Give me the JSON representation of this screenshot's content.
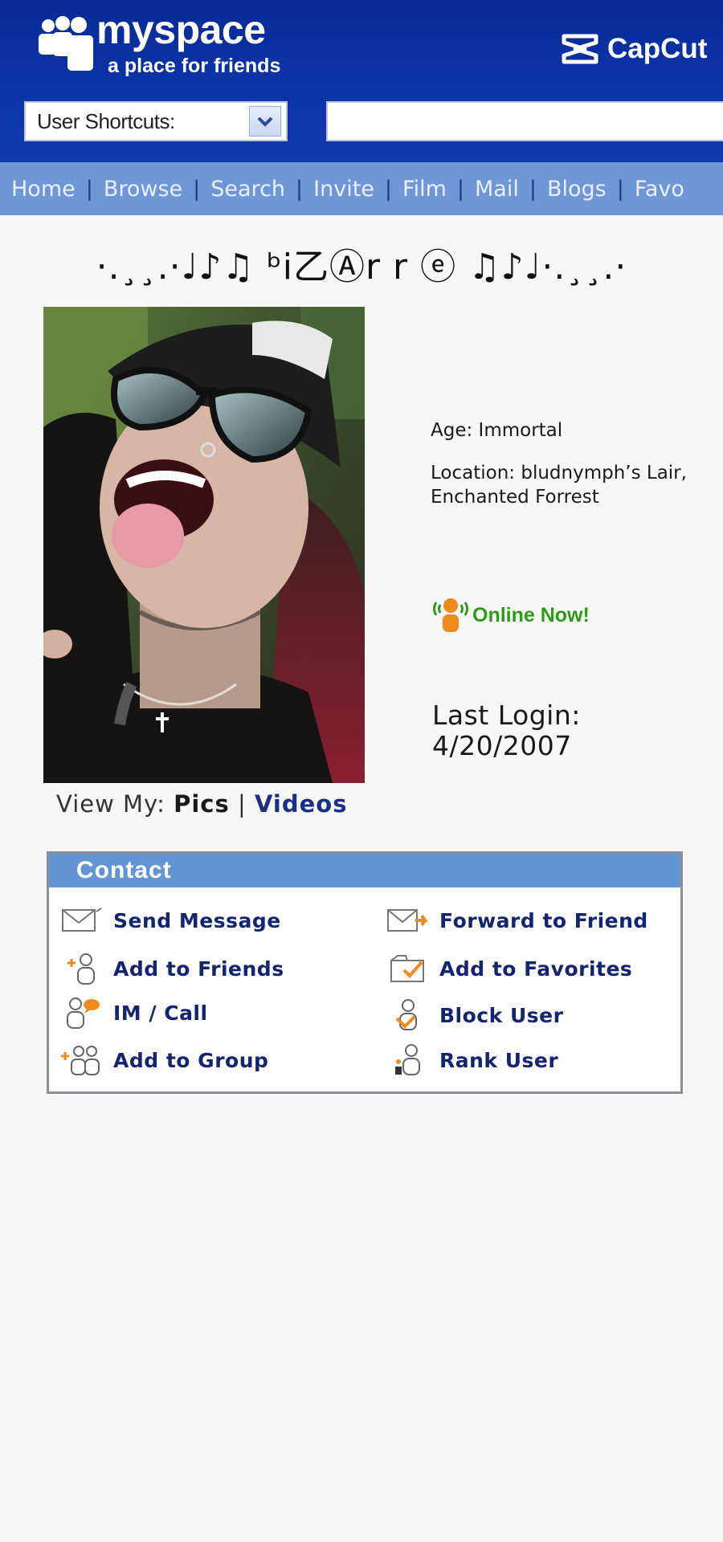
{
  "header": {
    "logo_word": "myspace",
    "logo_tagline": "a place for friends",
    "watermark": "CapCut",
    "shortcuts_label": "User Shortcuts:",
    "search_value": ""
  },
  "nav": {
    "items": [
      "Home",
      "Browse",
      "Search",
      "Invite",
      "Film",
      "Mail",
      "Blogs",
      "Favo"
    ]
  },
  "profile": {
    "display_name": "·.¸¸.·♩♪♫ ᵇi乙Ⓐr r ⓔ ♫♪♩·.¸¸.·",
    "age": "Age: Immortal",
    "location_line1": "Location: bludnymph’s Lair,",
    "location_line2": "Enchanted Forrest",
    "online_status": "Online Now!",
    "last_login_label": "Last Login:",
    "last_login_date": "4/20/2007",
    "view_my_label": "View My:",
    "view_my_pics": "Pics",
    "view_my_sep": "|",
    "view_my_videos": "Videos"
  },
  "contact": {
    "title": "Contact",
    "actions": [
      {
        "label": "Send Message",
        "icon": "envelope-icon"
      },
      {
        "label": "Forward to Friend",
        "icon": "forward-envelope-icon"
      },
      {
        "label": "Add to Friends",
        "icon": "add-friend-icon"
      },
      {
        "label": "Add to Favorites",
        "icon": "favorites-icon"
      },
      {
        "label": "IM / Call",
        "icon": "im-call-icon"
      },
      {
        "label": "Block User",
        "icon": "block-user-icon"
      },
      {
        "label": "Add to Group",
        "icon": "add-group-icon"
      },
      {
        "label": "Rank User",
        "icon": "rank-user-icon"
      }
    ]
  },
  "colors": {
    "header_bg": "#0b34a8",
    "nav_bg": "#6f96d6",
    "contact_header": "#6394d4",
    "online_green": "#2f9a18",
    "link_navy": "#14246e"
  }
}
